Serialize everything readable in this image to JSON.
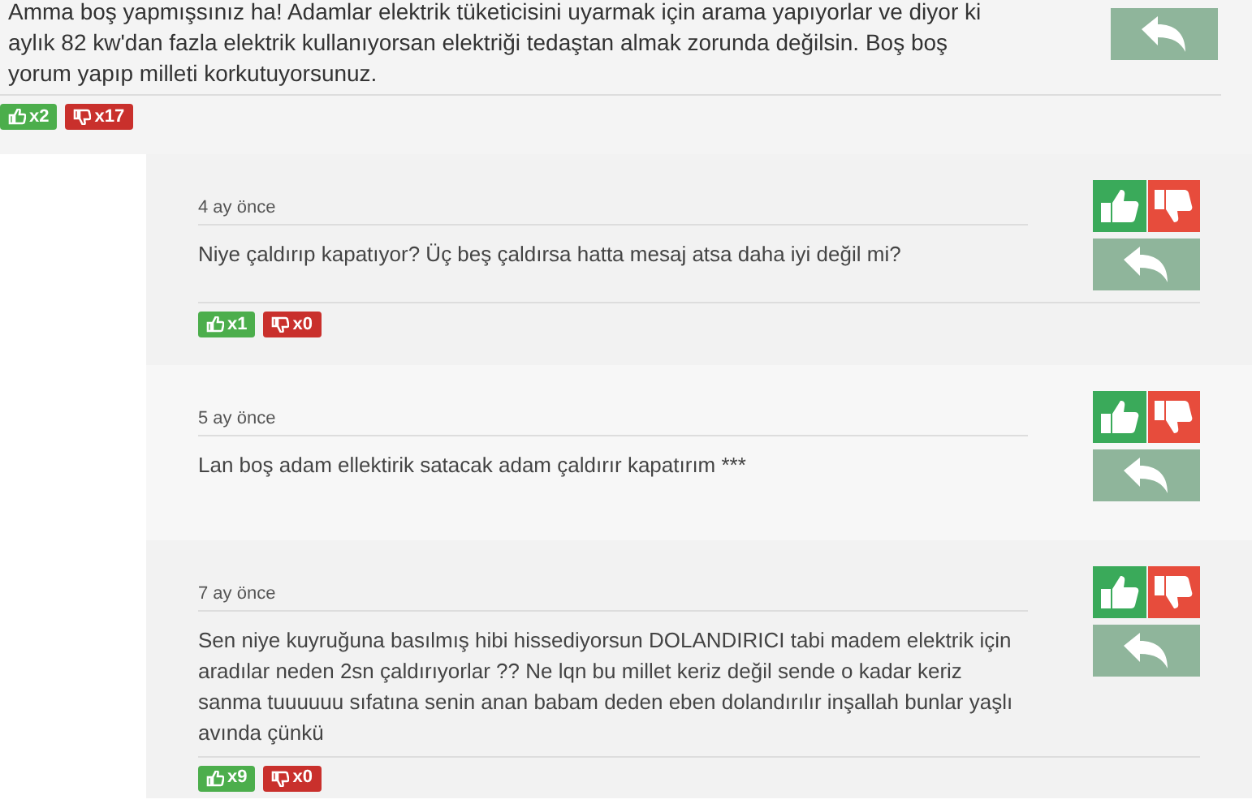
{
  "top_comment": {
    "text": "Amma boş yapmışsınız ha! Adamlar elektrik tüketicisini uyarmak için arama yapıyorlar ve diyor ki aylık 82 kw'dan fazla elektrik kullanıyorsan elektriği tedaştan almak zorunda değilsin. Boş boş yorum yapıp milleti korkutuyorsunuz.",
    "likes": "x2",
    "dislikes": "x17"
  },
  "replies": [
    {
      "time": "4 ay önce",
      "text": "Niye çaldırıp kapatıyor? Üç beş çaldırsa hatta mesaj atsa daha iyi değil mi?",
      "likes": "x1",
      "dislikes": "x0"
    },
    {
      "time": "5 ay önce",
      "text": "Lan boş adam ellektirik satacak adam çaldırır kapatırım ***"
    },
    {
      "time": "7 ay önce",
      "text": "Sen niye kuyruğuna basılmış hibi hissediyorsun DOLANDIRICI tabi madem elektrik için aradılar neden 2sn çaldırıyorlar ?? Ne lqn bu millet keriz değil sende o kadar keriz sanma tuuuuuu sıfatına senin anan babam deden eben dolandırılır inşallah bunlar yaşlı avında çünkü",
      "likes": "x9",
      "dislikes": "x0"
    }
  ]
}
